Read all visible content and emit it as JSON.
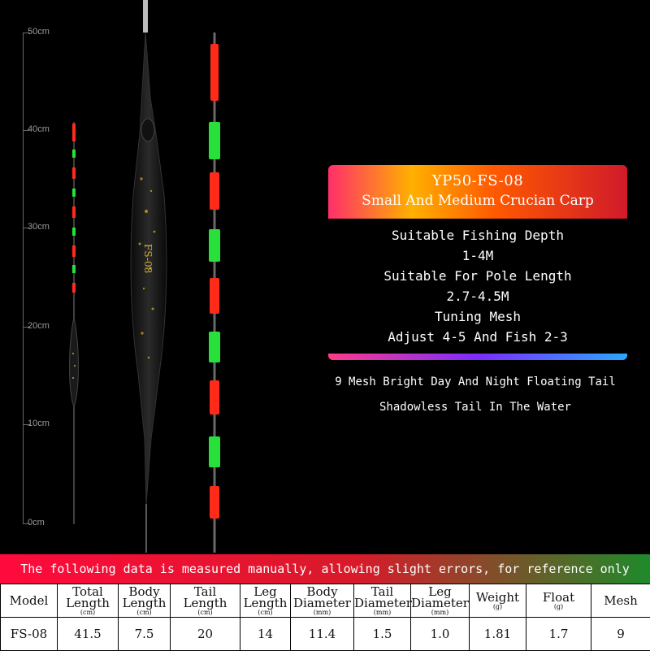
{
  "ruler": {
    "labels": [
      "50cm",
      "40cm",
      "30cm",
      "20cm",
      "10cm",
      "0cm"
    ]
  },
  "info": {
    "model_code": "YP50-FS-08",
    "subtitle": "Small And Medium Crucian Carp",
    "depth_label": "Suitable Fishing Depth",
    "depth_value": "1-4M",
    "pole_label": "Suitable For Pole Length",
    "pole_value": "2.7-4.5M",
    "tuning_label": "Tuning Mesh",
    "tuning_value": "Adjust 4-5 And Fish 2-3"
  },
  "taglines": {
    "line1": "9 Mesh Bright Day And Night Floating Tail",
    "line2": "Shadowless Tail In The Water"
  },
  "banner": "The following data is measured manually, allowing slight errors, for reference only",
  "table": {
    "headers": [
      {
        "label": "Model",
        "unit": ""
      },
      {
        "label": "Total Length",
        "unit": "(cm)"
      },
      {
        "label": "Body Length",
        "unit": "(cm)"
      },
      {
        "label": "Tail Length",
        "unit": "(cm)"
      },
      {
        "label": "Leg Length",
        "unit": "(cm)"
      },
      {
        "label": "Body Diameter",
        "unit": "(mm)"
      },
      {
        "label": "Tail Diameter",
        "unit": "(mm)"
      },
      {
        "label": "Leg Diameter",
        "unit": "(mm)"
      },
      {
        "label": "Weight",
        "unit": "(g)"
      },
      {
        "label": "Float",
        "unit": "(g)"
      },
      {
        "label": "Mesh",
        "unit": ""
      }
    ],
    "row": [
      "FS-08",
      "41.5",
      "7.5",
      "20",
      "14",
      "11.4",
      "1.5",
      "1.0",
      "1.81",
      "1.7",
      "9"
    ]
  },
  "colors": {
    "tail_red": "#ff2a1a",
    "tail_green": "#27e03a",
    "banner_red": "#ff0a3c",
    "banner_green": "#1e8a2a"
  },
  "icons": [
    "float-illustration",
    "floating-tail-illustration"
  ]
}
